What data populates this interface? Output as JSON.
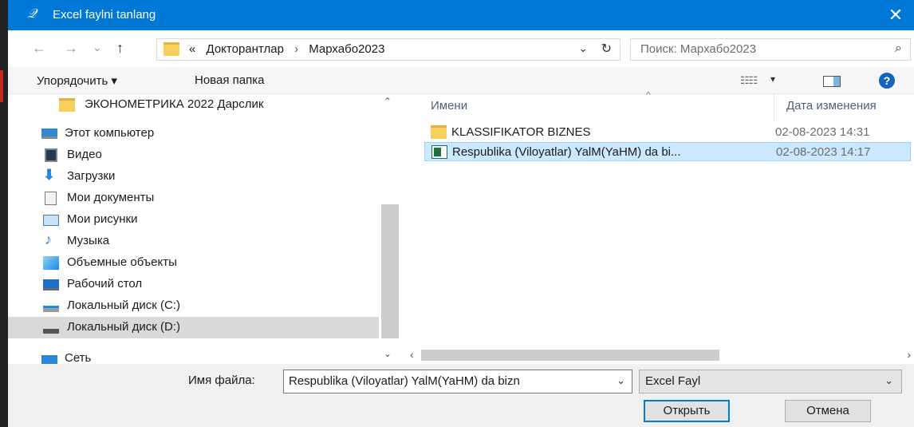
{
  "window": {
    "title": "Excel faylni tanlang",
    "close_glyph": "✕",
    "app_icon": "feather-icon"
  },
  "nav_buttons": {
    "back": "←",
    "forward": "→",
    "recent": "⌄",
    "up": "↑"
  },
  "address": {
    "overflow": "«",
    "crumbs": [
      "Докторантлар",
      "Мархабо2023"
    ],
    "separator": "›",
    "dropdown": "⌄",
    "refresh": "↻"
  },
  "search": {
    "placeholder": "Поиск: Мархабо2023",
    "icon": "🔍"
  },
  "toolbar": {
    "organize": "Упорядочить ▾",
    "new_folder": "Новая папка",
    "view_glyph": "☷☷",
    "view_dropdown": "▾",
    "help": "?"
  },
  "nav_pane": {
    "items": [
      {
        "label": "ЭКОНОМЕТРИКА 2022 Дарслик",
        "icon": "folder-icon"
      },
      {
        "label": "Этот компьютер",
        "icon": "computer-icon"
      },
      {
        "label": "Видео",
        "icon": "video-icon"
      },
      {
        "label": "Загрузки",
        "icon": "download-icon"
      },
      {
        "label": "Мои документы",
        "icon": "documents-icon"
      },
      {
        "label": "Мои рисунки",
        "icon": "pictures-icon"
      },
      {
        "label": "Музыка",
        "icon": "music-icon"
      },
      {
        "label": "Объемные объекты",
        "icon": "3d-objects-icon"
      },
      {
        "label": "Рабочий стол",
        "icon": "desktop-icon"
      },
      {
        "label": "Локальный диск (C:)",
        "icon": "drive-c-icon"
      },
      {
        "label": "Локальный диск (D:)",
        "icon": "drive-d-icon"
      },
      {
        "label": "Сеть",
        "icon": "network-icon"
      }
    ],
    "selected": "Локальный диск (D:)"
  },
  "file_list": {
    "columns": {
      "name": "Имени",
      "date": "Дата изменения"
    },
    "sort_arrow": "^",
    "rows": [
      {
        "name": "KLASSIFIKATOR BIZNES",
        "date": "02-08-2023 14:31",
        "type": "folder"
      },
      {
        "name": "Respublika (Viloyatlar) YalM(YaHM) da bi...",
        "date": "02-08-2023 14:17",
        "type": "excel"
      }
    ],
    "selected_index": 1
  },
  "scroll": {
    "up": "⌃",
    "down": "⌄",
    "left": "‹",
    "right": "›"
  },
  "bottom": {
    "file_name_label": "Имя файла:",
    "file_name_value": "Respublika (Viloyatlar) YalM(YaHM) da bizn",
    "file_name_dropdown": "⌄",
    "file_type": "Excel Fayl",
    "file_type_dropdown": "⌄",
    "open_button": "Открыть",
    "cancel_button": "Отмена"
  },
  "colors": {
    "titlebar": "#0078d7",
    "selection": "#cce8ff",
    "nav_selected": "#d9d9d9",
    "folder": "#f6cf5c"
  }
}
